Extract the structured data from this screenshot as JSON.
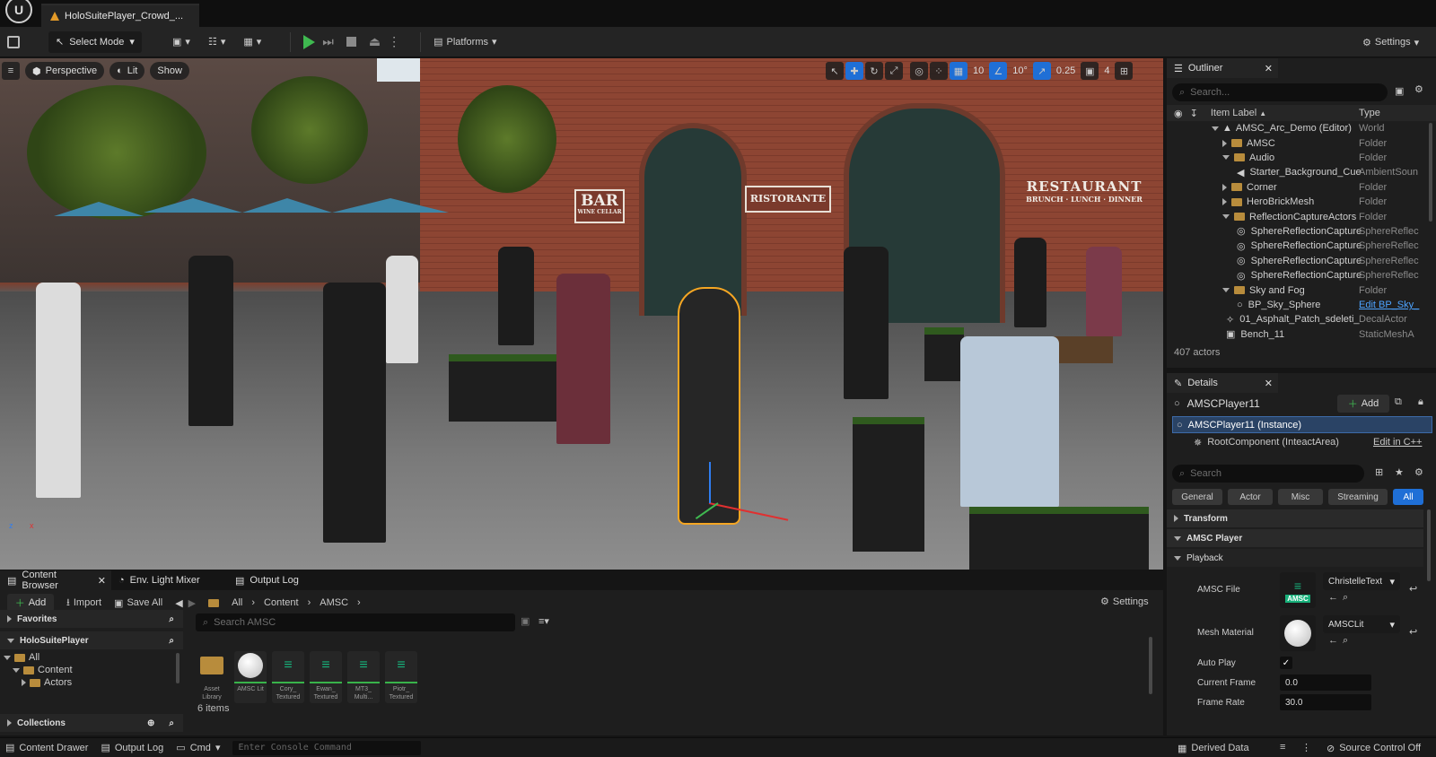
{
  "window": {
    "tab_title": "HoloSuitePlayer_Crowd_...",
    "logo": "unreal-engine-logo"
  },
  "toolbar": {
    "select_mode": "Select Mode",
    "platforms": "Platforms",
    "settings": "Settings"
  },
  "viewport": {
    "perspective": "Perspective",
    "lit": "Lit",
    "show": "Show",
    "grid_snap": "10",
    "rotation_snap": "10°",
    "scale_snap": "0.25",
    "camera_speed": "4",
    "signs": {
      "bar": "BAR",
      "bar_sub": "WINE CELLAR",
      "ristorante": "RISTORANTE",
      "restaurant": "RESTAURANT",
      "restaurant_sub": "BRUNCH · LUNCH · DINNER"
    },
    "gizmo_labels": {
      "x": "x",
      "z": "z"
    }
  },
  "outliner": {
    "tab": "Outliner",
    "search_placeholder": "Search...",
    "col_label": "Item Label",
    "col_type": "Type",
    "rows": [
      {
        "label": "AMSC_Arc_Demo (Editor)",
        "type": "World"
      },
      {
        "label": "AMSC",
        "type": "Folder"
      },
      {
        "label": "Audio",
        "type": "Folder"
      },
      {
        "label": "Starter_Background_Cue",
        "type": "AmbientSoun"
      },
      {
        "label": "Corner",
        "type": "Folder"
      },
      {
        "label": "HeroBrickMesh",
        "type": "Folder"
      },
      {
        "label": "ReflectionCaptureActors",
        "type": "Folder"
      },
      {
        "label": "SphereReflectionCapture",
        "type": "SphereReflec"
      },
      {
        "label": "SphereReflectionCapture",
        "type": "SphereReflec"
      },
      {
        "label": "SphereReflectionCapture",
        "type": "SphereReflec"
      },
      {
        "label": "SphereReflectionCapture",
        "type": "SphereReflec"
      },
      {
        "label": "Sky and Fog",
        "type": "Folder"
      },
      {
        "label": "BP_Sky_Sphere",
        "type": "Edit BP_Sky_"
      },
      {
        "label": "01_Asphalt_Patch_sdeleti_",
        "type": "DecalActor"
      },
      {
        "label": "Bench_11",
        "type": "StaticMeshA"
      }
    ],
    "actor_count": "407 actors"
  },
  "details": {
    "tab": "Details",
    "actor_name": "AMSCPlayer11",
    "add": "Add",
    "instance": "AMSCPlayer11 (Instance)",
    "root_component": "RootComponent (InteactArea)",
    "edit_cpp": "Edit in C++",
    "search_placeholder": "Search",
    "filters": [
      "General",
      "Actor",
      "Misc",
      "Streaming",
      "All"
    ],
    "sections": {
      "transform": "Transform",
      "amsc_player": "AMSC Player",
      "playback": "Playback"
    },
    "props": {
      "amsc_file_label": "AMSC File",
      "amsc_file_value": "ChristelleText",
      "amsc_thumb": "AMSC",
      "mesh_material_label": "Mesh Material",
      "mesh_material_value": "AMSCLit",
      "auto_play_label": "Auto Play",
      "auto_play_checked": true,
      "current_frame_label": "Current Frame",
      "current_frame_value": "0.0",
      "frame_rate_label": "Frame Rate",
      "frame_rate_value": "30.0"
    }
  },
  "bottom_tabs": {
    "content_browser": "Content Browser",
    "env_light_mixer": "Env. Light Mixer",
    "output_log": "Output Log"
  },
  "content_browser": {
    "add": "Add",
    "import": "Import",
    "save_all": "Save All",
    "breadcrumb": [
      "All",
      "Content",
      "AMSC"
    ],
    "settings": "Settings",
    "favorites": "Favorites",
    "project": "HoloSuitePlayer",
    "tree": [
      "All",
      "Content",
      "Actors"
    ],
    "collections": "Collections",
    "search_placeholder": "Search AMSC",
    "items": [
      {
        "name": "Asset Library",
        "kind": "folder"
      },
      {
        "name": "AMSC Lit",
        "kind": "sphere"
      },
      {
        "name": "Cory_ Textured",
        "kind": "amsc"
      },
      {
        "name": "Ewan_ Textured",
        "kind": "amsc"
      },
      {
        "name": "MT3_ Multi...",
        "kind": "amsc"
      },
      {
        "name": "Piotr_ Textured",
        "kind": "amsc"
      }
    ],
    "item_count": "6 items"
  },
  "statusbar": {
    "content_drawer": "Content Drawer",
    "output_log": "Output Log",
    "cmd": "Cmd",
    "console_placeholder": "Enter Console Command",
    "derived_data": "Derived Data",
    "source_control": "Source Control Off"
  },
  "colors": {
    "accent": "#1f6fd6",
    "play_green": "#3fb950",
    "selection_outline": "#f5a623",
    "amsc_green": "#17b07a"
  }
}
